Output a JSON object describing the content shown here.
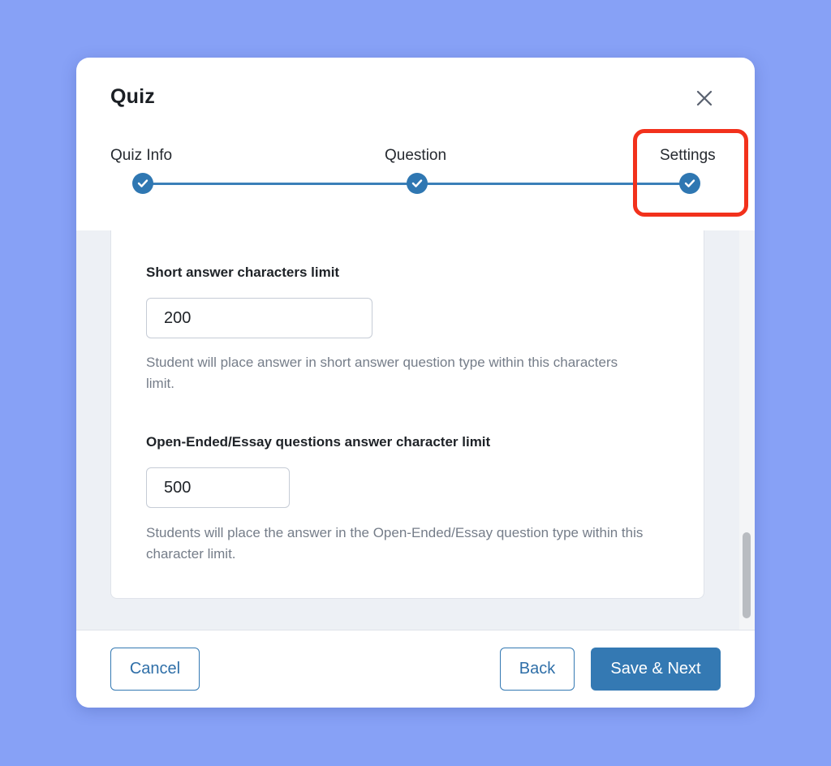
{
  "modal": {
    "title": "Quiz",
    "close_icon": "close-icon"
  },
  "stepper": {
    "steps": [
      {
        "label": "Quiz Info",
        "state": "completed",
        "icon": "check-icon"
      },
      {
        "label": "Question",
        "state": "completed",
        "icon": "check-icon"
      },
      {
        "label": "Settings",
        "state": "completed",
        "icon": "check-icon",
        "highlighted": true
      }
    ]
  },
  "settings": {
    "short_answer": {
      "label": "Short answer characters limit",
      "value": "200",
      "help": "Student will place answer in short answer question type within this characters limit."
    },
    "open_ended": {
      "label": "Open-Ended/Essay questions answer character limit",
      "value": "500",
      "help": "Students will place the answer in the Open-Ended/Essay question type within this character limit."
    }
  },
  "footer": {
    "cancel_label": "Cancel",
    "back_label": "Back",
    "save_next_label": "Save & Next"
  },
  "colors": {
    "page_background": "#87a1f6",
    "primary": "#3479b3",
    "highlight": "#f2311c"
  }
}
